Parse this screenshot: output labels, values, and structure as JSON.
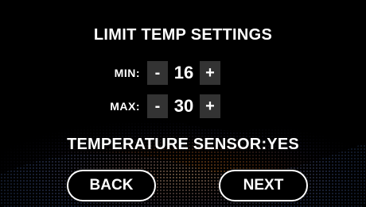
{
  "title": "LIMIT TEMP SETTINGS",
  "min": {
    "label": "MIN:",
    "minus": "-",
    "value": "16",
    "plus": "+"
  },
  "max": {
    "label": "MAX:",
    "minus": "-",
    "value": "30",
    "plus": "+"
  },
  "sensor_status": "TEMPERATURE SENSOR:YES",
  "buttons": {
    "back": "BACK",
    "next": "NEXT"
  },
  "colors": {
    "background": "#000000",
    "text": "#ffffff",
    "stepper_bg": "#333333"
  }
}
